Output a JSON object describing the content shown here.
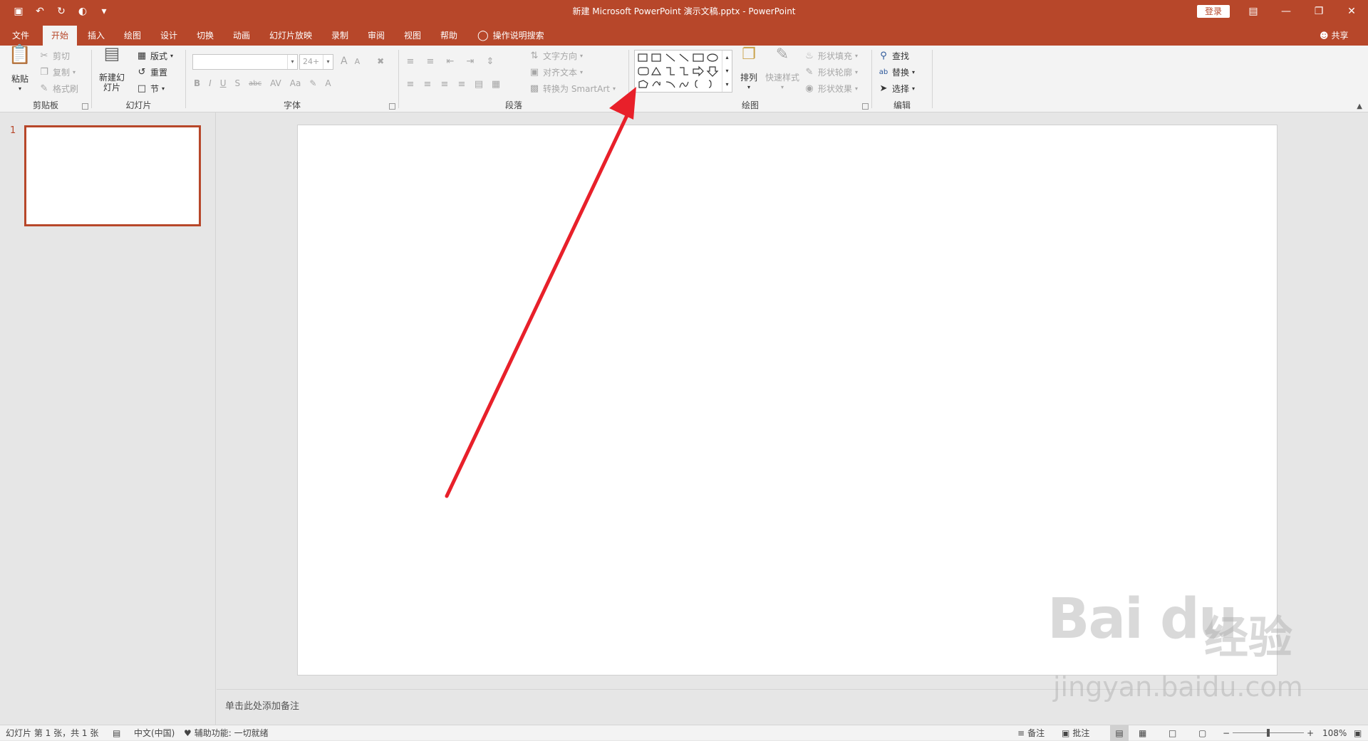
{
  "title_bar": {
    "title": "新建 Microsoft PowerPoint 演示文稿.pptx  -  PowerPoint",
    "login_label": "登录",
    "quick_access": [
      "save-icon",
      "undo-icon",
      "redo-icon",
      "present-icon",
      "customize-icon"
    ]
  },
  "tabs": [
    "文件",
    "开始",
    "插入",
    "绘图",
    "设计",
    "切换",
    "动画",
    "幻灯片放映",
    "录制",
    "审阅",
    "视图",
    "帮助"
  ],
  "active_tab": "开始",
  "tell_me": "操作说明搜索",
  "share_label": "共享",
  "ribbon": {
    "clipboard": {
      "label": "剪贴板",
      "paste": "粘贴",
      "cut": "剪切",
      "copy": "复制",
      "format_painter": "格式刷"
    },
    "slides": {
      "label": "幻灯片",
      "new_slide": "新建幻灯片",
      "layout": "版式",
      "reset": "重置",
      "section": "节"
    },
    "font": {
      "label": "字体",
      "size_value": "24+",
      "bold": "B",
      "italic": "I",
      "underline": "U",
      "shadow": "S",
      "strike": "abc",
      "spacing": "AV",
      "case": "Aa",
      "grow": "A",
      "shrink": "A",
      "color": "A"
    },
    "paragraph": {
      "label": "段落",
      "text_direction": "文字方向",
      "align_text": "对齐文本",
      "smartart": "转换为 SmartArt"
    },
    "drawing": {
      "label": "绘图",
      "arrange": "排列",
      "quick_styles": "快速样式",
      "shape_fill": "形状填充",
      "shape_outline": "形状轮廓",
      "shape_effects": "形状效果"
    },
    "editing": {
      "label": "编辑",
      "find": "查找",
      "replace": "替换",
      "select": "选择"
    }
  },
  "slides_pane": {
    "slide_number": "1"
  },
  "notes_placeholder": "单击此处添加备注",
  "status": {
    "slide_info": "幻灯片 第 1 张，共 1 张",
    "language": "中文(中国)",
    "accessibility": "辅助功能: 一切就绪",
    "notes": "备注",
    "comments": "批注",
    "zoom": "108%"
  },
  "watermark": {
    "logo": "Bai du",
    "cn": "经验",
    "url": "jingyan.baidu.com"
  },
  "colors": {
    "brand": "#b7472a",
    "arrow": "#e8202a"
  }
}
